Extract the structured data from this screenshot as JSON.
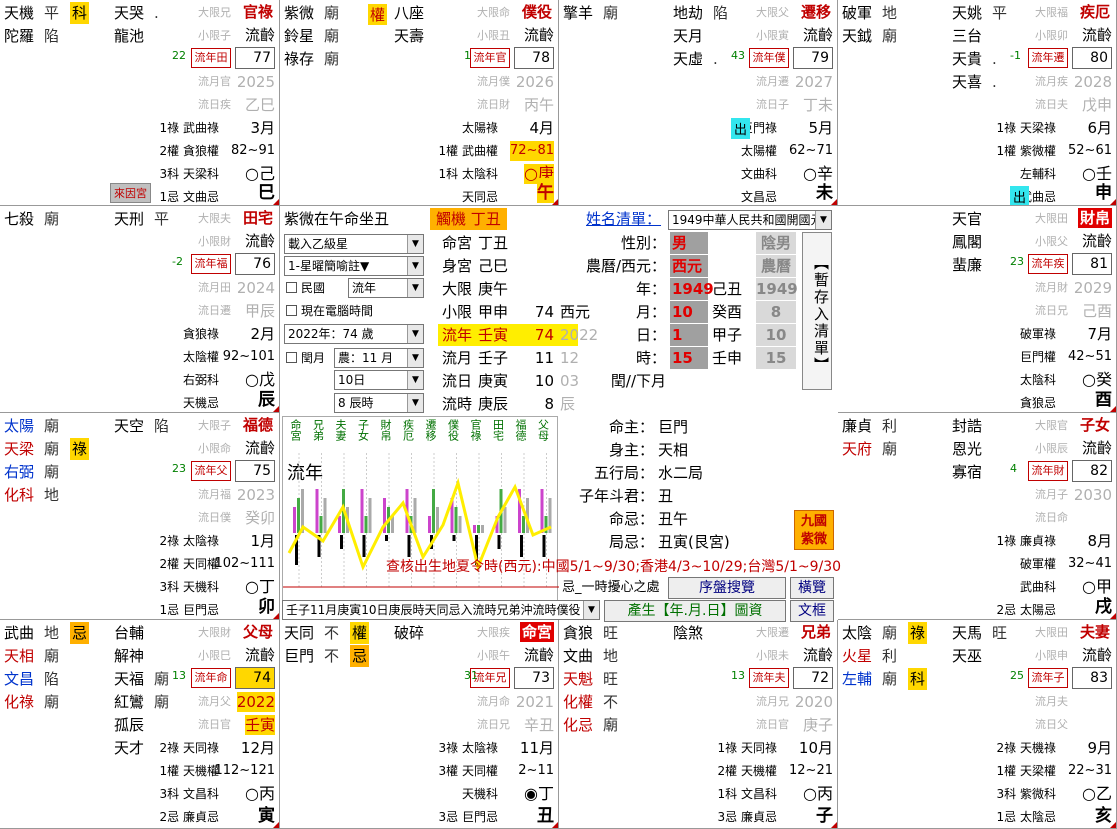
{
  "palaces": {
    "si": {
      "name": "官祿",
      "age": "流齡",
      "n1": "77",
      "year": "2025",
      "gz": "乙巳",
      "month": "3月",
      "range": "82~91",
      "stem": "巳",
      "stem_pre": "○己",
      "t1": "大限兄",
      "t2": "小限子",
      "t3": "流月官",
      "t4": "流日疾",
      "rbox": "流年田",
      "leftnum": "22",
      "stars": [
        {
          "n": "天機",
          "b": "平",
          "tag": "科"
        },
        {
          "n": "陀羅",
          "b": "陷"
        }
      ],
      "mstars": [
        {
          "n": "天哭",
          "b": "."
        },
        {
          "n": "龍池",
          "b": ""
        }
      ],
      "hua": [
        [
          "1祿",
          "武曲祿"
        ],
        [
          "2權",
          "貪狼權"
        ],
        [
          "3科",
          "天梁科"
        ],
        [
          "1忌",
          "文曲忌"
        ]
      ],
      "note": "來因宮"
    },
    "wu": {
      "name": "僕役",
      "age": "流齡",
      "n1": "78",
      "year": "2026",
      "gz": "丙午",
      "month": "4月",
      "range": "72~81",
      "stem": "午",
      "stem_pre": "○庚",
      "t1": "大限命",
      "t2": "小限丑",
      "t3": "流月僕",
      "t4": "流日財",
      "rbox": "流年官",
      "leftnum": "1",
      "stars": [
        {
          "n": "紫微",
          "b": "廟"
        },
        {
          "n": "鈴星",
          "b": "廟"
        },
        {
          "n": "祿存",
          "b": "廟"
        }
      ],
      "mstars": [
        {
          "n": "八座",
          "b": ""
        },
        {
          "n": "天壽",
          "b": ""
        }
      ],
      "tag_q": "權",
      "hua": [
        [
          "",
          "太陽祿"
        ],
        [
          "1權",
          "武曲權"
        ],
        [
          "1科",
          "太陰科"
        ],
        [
          "",
          "天同忌"
        ]
      ]
    },
    "wei": {
      "name": "遷移",
      "age": "流齡",
      "n1": "79",
      "year": "2027",
      "gz": "丁未",
      "month": "5月",
      "range": "62~71",
      "stem": "未",
      "stem_pre": "○辛",
      "t1": "大限父",
      "t2": "小限寅",
      "t3": "流月遷",
      "t4": "流日子",
      "rbox": "流年僕",
      "leftnum": "43",
      "stars": [
        {
          "n": "擎羊",
          "b": "廟"
        }
      ],
      "mstars": [
        {
          "n": "地劫",
          "b": "陷"
        },
        {
          "n": "天月",
          "b": ""
        },
        {
          "n": "天虛",
          "b": "."
        }
      ],
      "hua": [
        [
          "",
          "巨門祿"
        ],
        [
          "",
          "太陽權"
        ],
        [
          "",
          "文曲科"
        ],
        [
          "",
          "文昌忌"
        ]
      ],
      "chu": "出"
    },
    "shen": {
      "name": "疾厄",
      "age": "流齡",
      "n1": "80",
      "year": "2028",
      "gz": "戊申",
      "month": "6月",
      "range": "52~61",
      "stem": "申",
      "stem_pre": "○壬",
      "t1": "大限福",
      "t2": "小限卯",
      "t3": "流月疾",
      "t4": "流日夫",
      "rbox": "流年遷",
      "leftnum": "-1",
      "stars": [
        {
          "n": "破軍",
          "b": "地"
        },
        {
          "n": "天鉞",
          "b": "廟"
        }
      ],
      "mstars": [
        {
          "n": "天姚",
          "b": "平"
        },
        {
          "n": "三台",
          "b": ""
        },
        {
          "n": "天貴",
          "b": "."
        },
        {
          "n": "天喜",
          "b": "."
        }
      ],
      "hua": [
        [
          "1祿",
          "天梁祿"
        ],
        [
          "1權",
          "紫微權"
        ],
        [
          "",
          "左輔科"
        ],
        [
          "",
          "武曲忌"
        ]
      ],
      "chu": "出"
    },
    "chen": {
      "name": "田宅",
      "age": "流齡",
      "n1": "76",
      "year": "2024",
      "gz": "甲辰",
      "month": "2月",
      "range": "92~101",
      "stem": "辰",
      "stem_pre": "○戊",
      "t1": "大限夫",
      "t2": "小限財",
      "t3": "流月田",
      "t4": "流日遷",
      "rbox": "流年福",
      "leftnum": "-2",
      "stars": [
        {
          "n": "七殺",
          "b": "廟"
        }
      ],
      "mstars": [
        {
          "n": "天刑",
          "b": "平"
        }
      ],
      "hua": [
        [
          "",
          "貪狼祿"
        ],
        [
          "",
          "太陰權"
        ],
        [
          "",
          "右弼科"
        ],
        [
          "",
          "天機忌"
        ]
      ]
    },
    "you": {
      "name": "財帛",
      "age": "流齡",
      "n1": "81",
      "year": "2029",
      "gz": "己酉",
      "month": "7月",
      "range": "42~51",
      "stem": "酉",
      "stem_pre": "○癸",
      "t1": "大限田",
      "t2": "小限父",
      "t3": "流月財",
      "t4": "流日兄",
      "rbox": "流年疾",
      "leftnum": "23",
      "stars": [],
      "mstars": [
        {
          "n": "天官",
          "b": ""
        },
        {
          "n": "鳳閣",
          "b": ""
        },
        {
          "n": "蜚廉",
          "b": ""
        }
      ],
      "hua": [
        [
          "",
          "破軍祿"
        ],
        [
          "",
          "巨門權"
        ],
        [
          "",
          "太陰科"
        ],
        [
          "",
          "貪狼忌"
        ]
      ]
    },
    "mao": {
      "name": "福德",
      "age": "流齡",
      "n1": "75",
      "year": "2023",
      "gz": "癸卯",
      "month": "1月",
      "range": "102~111",
      "stem": "卯",
      "stem_pre": "○丁",
      "t1": "大限子",
      "t2": "小限命",
      "t3": "流月福",
      "t4": "流日僕",
      "rbox": "流年父",
      "leftnum": "23",
      "stars": [
        {
          "n": "太陽",
          "b": "廟",
          "c": "blue"
        },
        {
          "n": "天梁",
          "b": "廟",
          "c": "red",
          "tag": "祿"
        },
        {
          "n": "右弼",
          "b": "廟",
          "c": "blue"
        },
        {
          "n": "化科",
          "b": "地",
          "c": "red"
        }
      ],
      "mstars": [
        {
          "n": "天空",
          "b": "陷"
        }
      ],
      "hua": [
        [
          "2祿",
          "太陰祿"
        ],
        [
          "2權",
          "天同權"
        ],
        [
          "3科",
          "天機科"
        ],
        [
          "1忌",
          "巨門忌"
        ]
      ]
    },
    "xu": {
      "name": "子女",
      "age": "流齡",
      "n1": "82",
      "year": "2030",
      "gz": "",
      "month": "8月",
      "range": "32~41",
      "stem": "戌",
      "stem_pre": "○甲",
      "t1": "大限官",
      "t2": "小限辰",
      "t3": "流月子",
      "t4": "流日命",
      "rbox": "流年財",
      "leftnum": "4",
      "stars": [
        {
          "n": "廉貞",
          "b": "利"
        },
        {
          "n": "天府",
          "b": "廟",
          "c": "red"
        }
      ],
      "mstars": [
        {
          "n": "封誥",
          "b": ""
        },
        {
          "n": "恩光",
          "b": ""
        },
        {
          "n": "寡宿",
          "b": ""
        }
      ],
      "hua": [
        [
          "1祿",
          "廉貞祿"
        ],
        [
          "",
          "破軍權"
        ],
        [
          "",
          "武曲科"
        ],
        [
          "2忌",
          "太陽忌"
        ]
      ]
    },
    "yin": {
      "name": "父母",
      "age": "流齡",
      "n1": "74",
      "year": "2022",
      "gz": "壬寅",
      "month": "12月",
      "range": "112~121",
      "stem": "寅",
      "stem_pre": "○丙",
      "t1": "大限財",
      "t2": "小限巳",
      "t3": "流月父",
      "t4": "流日官",
      "rbox": "流年命",
      "leftnum": "13",
      "stars": [
        {
          "n": "武曲",
          "b": "地",
          "tag": "忌"
        },
        {
          "n": "天相",
          "b": "廟",
          "c": "red"
        },
        {
          "n": "文昌",
          "b": "陷",
          "c": "blue"
        },
        {
          "n": "化祿",
          "b": "廟",
          "c": "red"
        }
      ],
      "mstars": [
        {
          "n": "台輔",
          "b": ""
        },
        {
          "n": "解神",
          "b": ""
        },
        {
          "n": "天福",
          "b": "廟"
        },
        {
          "n": "紅鸞",
          "b": "廟"
        },
        {
          "n": "孤辰",
          "b": ""
        },
        {
          "n": "天才",
          "b": ""
        }
      ],
      "hua": [
        [
          "2祿",
          "天同祿"
        ],
        [
          "1權",
          "天機權"
        ],
        [
          "3科",
          "文昌科"
        ],
        [
          "2忌",
          "廉貞忌"
        ]
      ]
    },
    "chou": {
      "name": "命宮",
      "age": "流齡",
      "n1": "73",
      "year": "2021",
      "gz": "辛丑",
      "month": "11月",
      "range": "2~11",
      "stem": "丑",
      "stem_pre": "◉丁",
      "t1": "大限疾",
      "t2": "小限午",
      "t3": "流月命",
      "t4": "流日兄",
      "rbox": "流年兄",
      "leftnum": "31",
      "stars": [
        {
          "n": "天同",
          "b": "不",
          "tag": "權"
        },
        {
          "n": "巨門",
          "b": "不",
          "tag": "忌"
        }
      ],
      "mstars": [
        {
          "n": "破碎",
          "b": ""
        }
      ],
      "hua": [
        [
          "3祿",
          "太陰祿"
        ],
        [
          "3權",
          "天同權"
        ],
        [
          "",
          "天機科"
        ],
        [
          "3忌",
          "巨門忌"
        ]
      ]
    },
    "zi": {
      "name": "兄弟",
      "age": "流齡",
      "n1": "72",
      "year": "2020",
      "gz": "庚子",
      "month": "10月",
      "range": "12~21",
      "stem": "子",
      "stem_pre": "○丙",
      "t1": "大限遷",
      "t2": "小限未",
      "t3": "流月兄",
      "t4": "流日官",
      "rbox": "流年夫",
      "leftnum": "13",
      "stars": [
        {
          "n": "貪狼",
          "b": "旺"
        },
        {
          "n": "文曲",
          "b": "地"
        },
        {
          "n": "天魁",
          "b": "旺",
          "c": "red"
        },
        {
          "n": "化權",
          "b": "不",
          "c": "red"
        },
        {
          "n": "化忌",
          "b": "廟",
          "c": "red"
        }
      ],
      "mstars": [
        {
          "n": "陰煞",
          "b": ""
        }
      ],
      "hua": [
        [
          "1祿",
          "天同祿"
        ],
        [
          "2權",
          "天機權"
        ],
        [
          "1科",
          "文昌科"
        ],
        [
          "3忌",
          "廉貞忌"
        ]
      ]
    },
    "hai": {
      "name": "夫妻",
      "age": "流齡",
      "n1": "83",
      "year": "",
      "gz": "",
      "month": "9月",
      "range": "22~31",
      "stem": "亥",
      "stem_pre": "○乙",
      "t1": "大限田",
      "t2": "小限申",
      "t3": "流月夫",
      "t4": "流日父",
      "rbox": "流年子",
      "leftnum": "25",
      "stars": [
        {
          "n": "太陰",
          "b": "廟",
          "tag": "祿"
        },
        {
          "n": "火星",
          "b": "利",
          "c": "red"
        },
        {
          "n": "左輔",
          "b": "廟",
          "c": "blue",
          "tag": "科"
        }
      ],
      "mstars": [
        {
          "n": "天馬",
          "b": "旺"
        },
        {
          "n": "天巫",
          "b": ""
        }
      ],
      "hua": [
        [
          "2祿",
          "天機祿"
        ],
        [
          "1權",
          "天梁權"
        ],
        [
          "3科",
          "紫微科"
        ],
        [
          "1忌",
          "太陰忌"
        ]
      ]
    }
  },
  "center": {
    "title": "紫微在午命坐丑",
    "pill": "觸機 丁丑",
    "link": "姓名清單：",
    "sel_country": "1949中華人民共和國開國元",
    "sel_load": "載入乙級星",
    "sel_star": "1-星曜簡喻註▼",
    "chk_minguo": "民國",
    "sel_liunian": "流年",
    "chk_now": "現在電腦時間",
    "sel_age": "2022年：74 歲",
    "chk_leap": "閏月",
    "sel_month": "農：11 月",
    "sel_day": "10日",
    "sel_hour": "8 辰時",
    "rows": [
      {
        "l": "命宮",
        "gz": "丁丑",
        "n": "",
        "y": ""
      },
      {
        "l": "身宮",
        "gz": "己巳",
        "n": "",
        "y": ""
      },
      {
        "l": "大限",
        "gz": "庚午",
        "n": "",
        "y": ""
      },
      {
        "l": "小限",
        "gz": "甲申",
        "n": "74",
        "y": "西元"
      },
      {
        "l": "流年",
        "gz": "壬寅",
        "n": "74",
        "y": "2022"
      },
      {
        "l": "流月",
        "gz": "壬子",
        "n": "11",
        "y": "12"
      },
      {
        "l": "流日",
        "gz": "庚寅",
        "n": "10",
        "y": "03"
      },
      {
        "l": "流時",
        "gz": "庚辰",
        "n": "8",
        "y": "辰"
      }
    ],
    "form": {
      "sex_l": "性別：",
      "sex": "男",
      "cal_l": "農曆/西元：",
      "cal": "西元",
      "year_l": "年：",
      "year": "1949",
      "year_gz": "己丑",
      "month_l": "月：",
      "month": "10",
      "month_gz": "癸酉",
      "day_l": "日：",
      "day": "1",
      "day_gz": "甲子",
      "hour_l": "時：",
      "hour": "15",
      "hour_gz": "壬申",
      "leap_l": "閏//下月",
      "yin": "陰男",
      "nongli": "農曆",
      "ny": "1949",
      "nm": "8",
      "nd": "10",
      "nh": "15"
    },
    "vbtn": "【暫存入清單】",
    "chart_label": "流年",
    "chart_cols": [
      "命宮",
      "兄弟",
      "夫妻",
      "子女",
      "財帛",
      "疾厄",
      "遷移",
      "僕役",
      "官祿",
      "田宅",
      "福德",
      "父母"
    ],
    "info": [
      [
        "命主：",
        "巨門"
      ],
      [
        "身主：",
        "天相"
      ],
      [
        "五行局：",
        "水二局"
      ],
      [
        "子年斗君：",
        "丑"
      ],
      [
        "命忌：",
        "丑午"
      ],
      [
        "局忌：",
        "丑寅(艮宮)"
      ]
    ],
    "jiuguo": "九國紫微",
    "marquee": "查核出生地夏令時(西元):中國5/1~9/30;香港4/3~10/29;台灣5/1~9/30",
    "bottom_left": "忌_一時擾心之處",
    "btn_search": "序盤搜覽",
    "btn_browse": "橫覽",
    "status": "壬子11月庚寅10日庚辰時天同忌入流時兄弟沖流時僕役",
    "btn_gen": "產生【年.月.日】圖資",
    "btn_wenkuang": "文框"
  },
  "chart_data": {
    "type": "bar",
    "categories": [
      "命宮",
      "兄弟",
      "夫妻",
      "子女",
      "財帛",
      "疾厄",
      "遷移",
      "僕役",
      "官祿",
      "田宅",
      "福德",
      "父母"
    ],
    "series": [
      {
        "name": "",
        "values": [
          1,
          2,
          3,
          2,
          4,
          2,
          3,
          4,
          5,
          3,
          2,
          2
        ]
      }
    ]
  }
}
